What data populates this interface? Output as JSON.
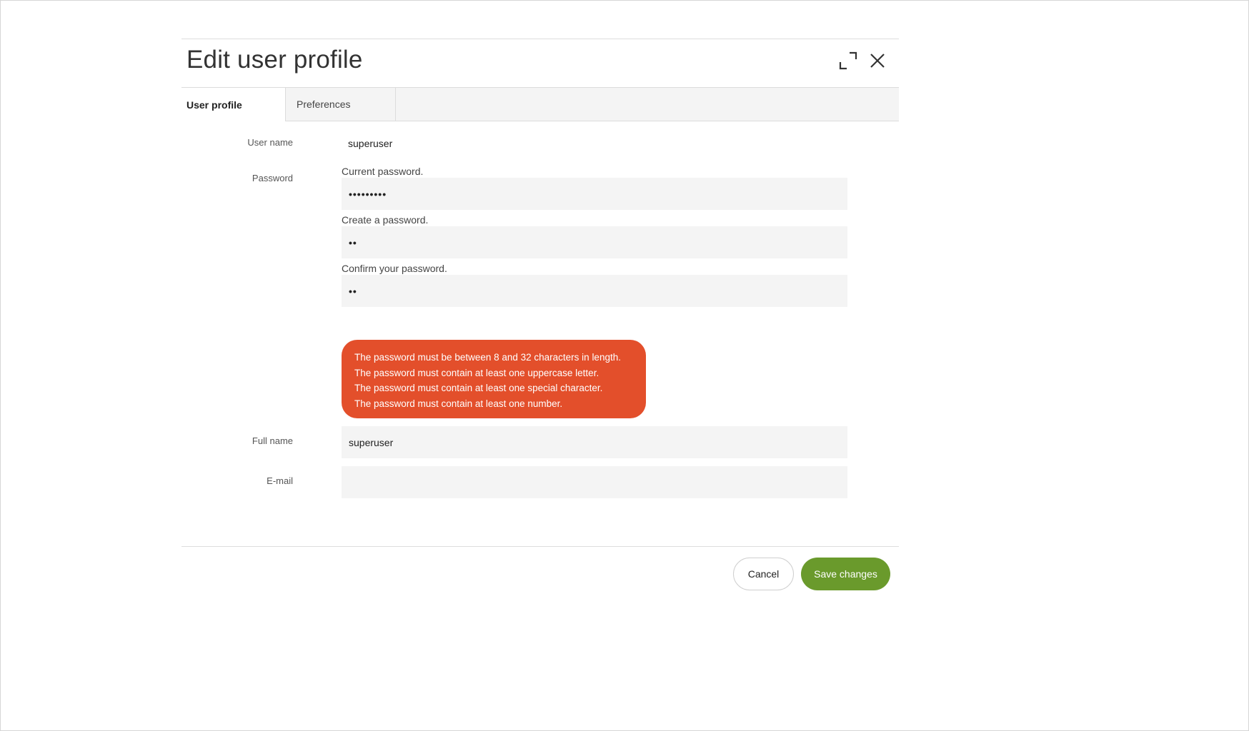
{
  "dialog": {
    "title": "Edit user profile",
    "expand_icon": "expand-icon",
    "close_icon": "close-icon"
  },
  "tabs": [
    {
      "label": "User profile",
      "active": true
    },
    {
      "label": "Preferences",
      "active": false
    }
  ],
  "form": {
    "username": {
      "label": "User name",
      "value": "superuser"
    },
    "password": {
      "label": "Password",
      "current_label": "Current password.",
      "current_value": "•••••••••",
      "create_label": "Create a password.",
      "create_value": "••",
      "confirm_label": "Confirm your password.",
      "confirm_value": "••"
    },
    "errors": [
      "The password must be between 8 and 32 characters in length.",
      "The password must contain at least one uppercase letter.",
      "The password must contain at least one special character.",
      "The password must contain at least one number."
    ],
    "fullname": {
      "label": "Full name",
      "value": "superuser"
    },
    "email": {
      "label": "E-mail",
      "value": ""
    }
  },
  "footer": {
    "cancel_label": "Cancel",
    "save_label": "Save changes"
  },
  "colors": {
    "error": "#e34f2b",
    "primary": "#6a9a2c",
    "field_bg": "#f4f4f4"
  }
}
